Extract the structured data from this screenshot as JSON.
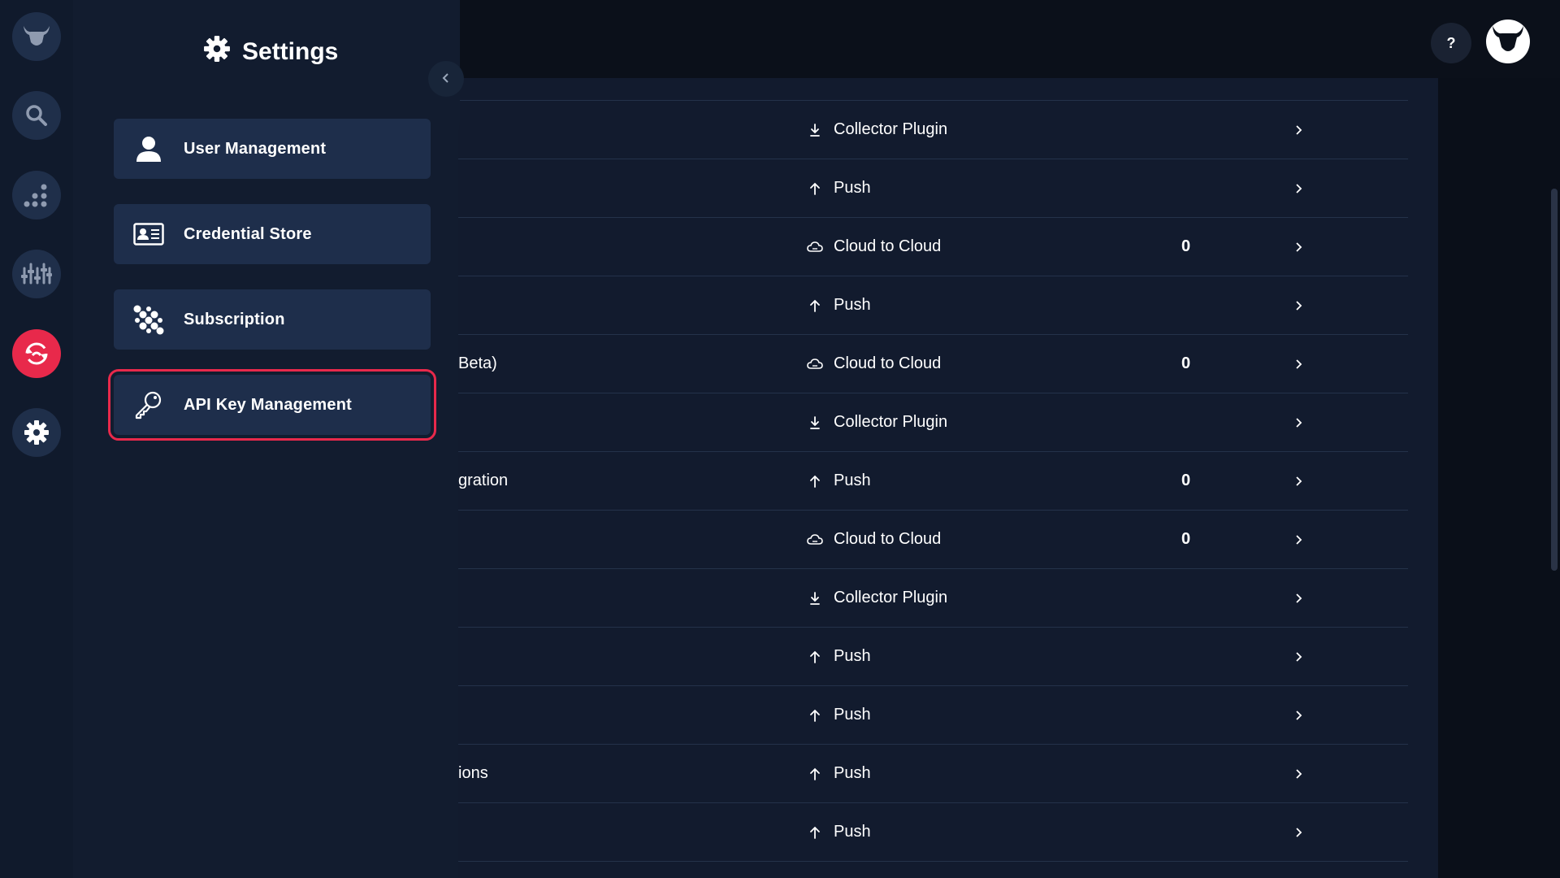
{
  "icons": {
    "rail": [
      "bull-logo-icon",
      "search-icon",
      "analytics-icon",
      "sliders-icon",
      "sync-icon",
      "gear-icon"
    ],
    "menu": [
      "user-icon",
      "id-card-icon",
      "subscription-icon",
      "key-icon"
    ]
  },
  "colors": {
    "accent": "#e8294b",
    "panel": "#121c2f",
    "menu_item": "#1e2e4b",
    "content": "#121b2e"
  },
  "panel": {
    "title": "Settings",
    "menu": [
      {
        "label": "User Management"
      },
      {
        "label": "Credential Store"
      },
      {
        "label": "Subscription"
      },
      {
        "label": "API Key Management"
      }
    ]
  },
  "header": {
    "help_label": "?"
  },
  "rows": [
    {
      "name": "",
      "type": "Collector Plugin",
      "icon": "download",
      "count": ""
    },
    {
      "name": "",
      "type": "Push",
      "icon": "up",
      "count": ""
    },
    {
      "name": "",
      "type": "Cloud to Cloud",
      "icon": "cloud",
      "count": "0"
    },
    {
      "name": "",
      "type": "Push",
      "icon": "up",
      "count": ""
    },
    {
      "name": "Beta)",
      "type": "Cloud to Cloud",
      "icon": "cloud",
      "count": "0"
    },
    {
      "name": "",
      "type": "Collector Plugin",
      "icon": "download",
      "count": ""
    },
    {
      "name": "gration",
      "type": "Push",
      "icon": "up",
      "count": "0"
    },
    {
      "name": "",
      "type": "Cloud to Cloud",
      "icon": "cloud",
      "count": "0"
    },
    {
      "name": "",
      "type": "Collector Plugin",
      "icon": "download",
      "count": ""
    },
    {
      "name": "",
      "type": "Push",
      "icon": "up",
      "count": ""
    },
    {
      "name": "",
      "type": "Push",
      "icon": "up",
      "count": ""
    },
    {
      "name": "ions",
      "type": "Push",
      "icon": "up",
      "count": ""
    },
    {
      "name": "",
      "type": "Push",
      "icon": "up",
      "count": ""
    }
  ]
}
